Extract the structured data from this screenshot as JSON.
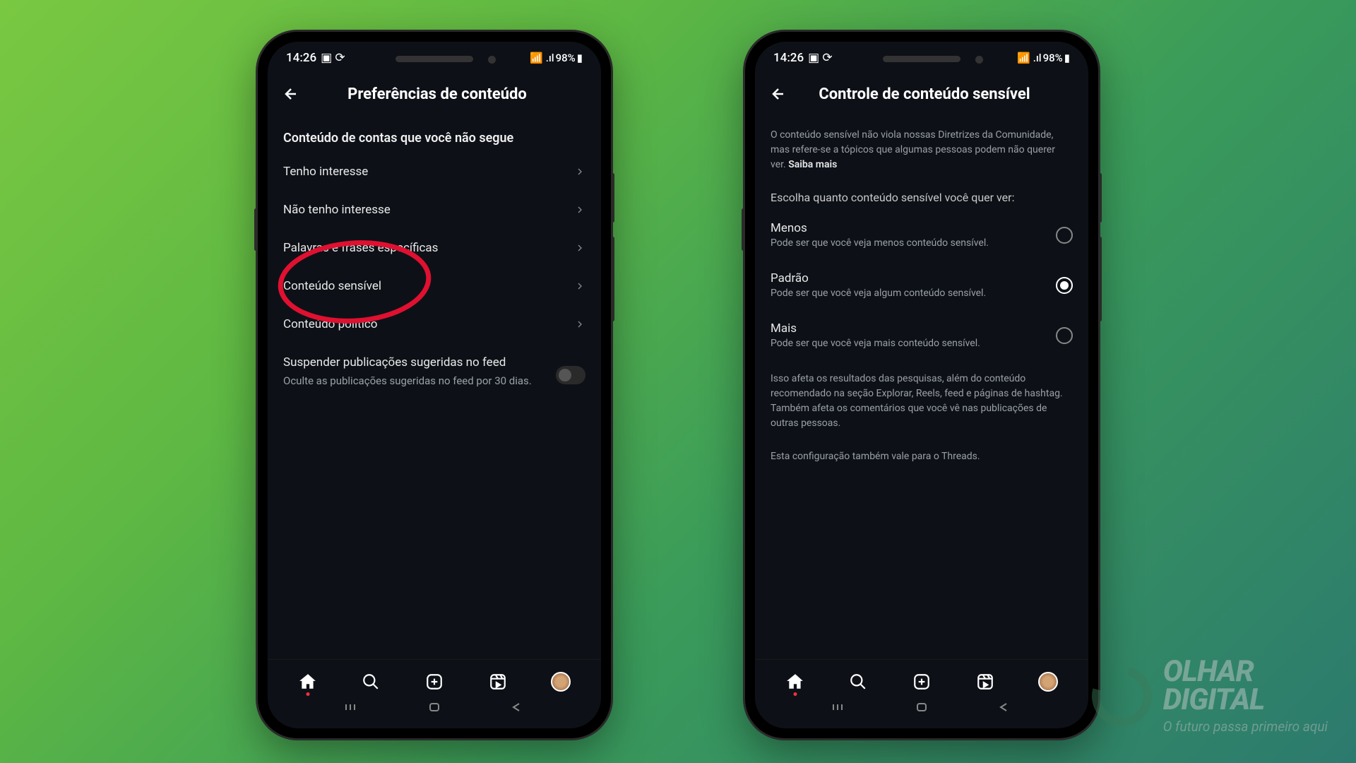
{
  "status": {
    "time": "14:26",
    "battery": "98%"
  },
  "phone1": {
    "header": "Preferências de conteúdo",
    "section": "Conteúdo de contas que você não segue",
    "items": [
      "Tenho interesse",
      "Não tenho interesse",
      "Palavras e frases específicas",
      "Conteúdo sensível",
      "Conteúdo político"
    ],
    "suspend": {
      "title": "Suspender publicações sugeridas no feed",
      "desc": "Oculte as publicações sugeridas no feed por 30 dias."
    }
  },
  "phone2": {
    "header": "Controle de conteúdo sensível",
    "intro": "O conteúdo sensível não viola nossas Diretrizes da Comunidade, mas refere-se a tópicos que algumas pessoas podem não querer ver.",
    "introLink": "Saiba mais",
    "prompt": "Escolha quanto conteúdo sensível você quer ver:",
    "options": [
      {
        "title": "Menos",
        "desc": "Pode ser que você veja menos conteúdo sensível.",
        "selected": false
      },
      {
        "title": "Padrão",
        "desc": "Pode ser que você veja algum conteúdo sensível.",
        "selected": true
      },
      {
        "title": "Mais",
        "desc": "Pode ser que você veja mais conteúdo sensível.",
        "selected": false
      }
    ],
    "footnote1": "Isso afeta os resultados das pesquisas, além do conteúdo recomendado na seção Explorar, Reels, feed e páginas de hashtag. Também afeta os comentários que você vê nas publicações de outras pessoas.",
    "footnote2": "Esta configuração também vale para o Threads."
  },
  "watermark": {
    "line1": "OLHAR",
    "line2": "DIGITAL",
    "tagline": "O futuro passa primeiro aqui"
  }
}
